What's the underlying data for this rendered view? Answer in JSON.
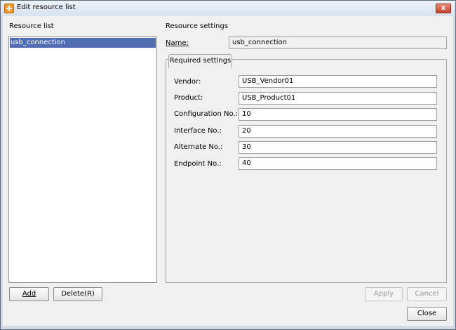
{
  "window": {
    "title": "Edit resource list",
    "close_label": "x"
  },
  "left": {
    "heading": "Resource list",
    "items": [
      "usb_connection"
    ],
    "add_label": "Add",
    "delete_label": "Delete(R)"
  },
  "right": {
    "heading": "Resource settings",
    "name_label": "Name:",
    "name_value": "usb_connection",
    "tab_label": "Required settings",
    "fields": [
      {
        "label": "Vendor:",
        "value": "USB_Vendor01"
      },
      {
        "label": "Product:",
        "value": "USB_Product01"
      },
      {
        "label": "Configuration No.:",
        "value": "10"
      },
      {
        "label": "Interface No.:",
        "value": "20"
      },
      {
        "label": "Alternate No.:",
        "value": "30"
      },
      {
        "label": "Endpoint No.:",
        "value": "40"
      }
    ]
  },
  "buttons": {
    "apply": "Apply",
    "cancel": "Cancel",
    "close": "Close"
  }
}
